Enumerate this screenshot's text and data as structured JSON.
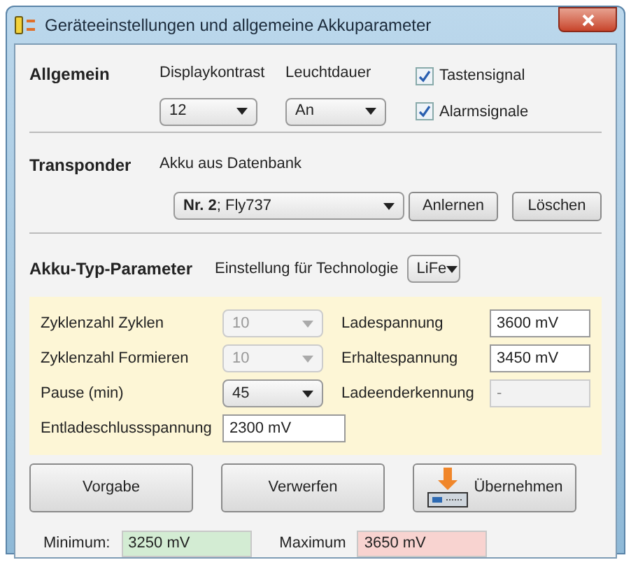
{
  "window": {
    "title": "Geräteeinstellungen und allgemeine Akkuparameter"
  },
  "general": {
    "heading": "Allgemein",
    "display_contrast": {
      "label": "Displaykontrast",
      "value": "12"
    },
    "backlight": {
      "label": "Leuchtdauer",
      "value": "An"
    },
    "checkboxes": [
      {
        "label": "Tastensignal",
        "checked": true
      },
      {
        "label": "Alarmsignale",
        "checked": true
      }
    ]
  },
  "transponder": {
    "heading": "Transponder",
    "label": "Akku aus Datenbank",
    "value": "**Nr. 2**; Fly737",
    "buttons": [
      "Anlernen",
      "Löschen"
    ]
  },
  "battery_type": {
    "heading": "Akku-Typ-Parameter",
    "technology_label": "Einstellung für Technologie",
    "technology": "LiFe",
    "fields": [
      {
        "kind": "combo",
        "label": "Zyklenzahl Zyklen",
        "value": "10",
        "disabled": true
      },
      {
        "kind": "input",
        "label": "Ladespannung",
        "value": "3600 mV",
        "disabled": false
      },
      {
        "kind": "combo",
        "label": "Zyklenzahl Formieren",
        "value": "10",
        "disabled": true
      },
      {
        "kind": "input",
        "label": "Erhaltespannung",
        "value": "3450 mV",
        "disabled": false
      },
      {
        "kind": "combo",
        "label": "Pause (min)",
        "value": "45",
        "disabled": false
      },
      {
        "kind": "input",
        "label": "Ladeenderkennung",
        "value": "-",
        "disabled": true
      },
      {
        "kind": "input",
        "label": "Entladeschlussspannung",
        "value": "2300 mV",
        "disabled": false
      }
    ]
  },
  "buttons": [
    {
      "label": "Vorgabe",
      "kind": "plain"
    },
    {
      "label": "Verwerfen",
      "kind": "plain"
    },
    {
      "label": "Übernehmen",
      "kind": "transfer"
    }
  ],
  "limits": [
    {
      "label": "Minimum:",
      "value": "3250 mV",
      "color": "#d3ecd3"
    },
    {
      "label": "Maximum",
      "value": "3650 mV",
      "color": "#f8d3d0"
    }
  ]
}
